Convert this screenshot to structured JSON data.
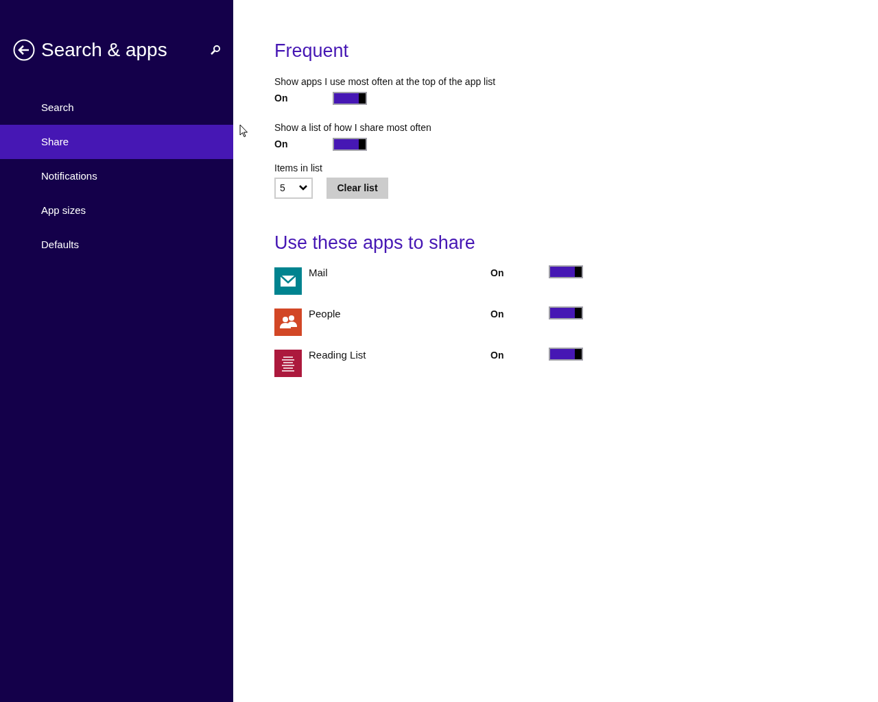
{
  "sidebar": {
    "title": "Search & apps",
    "items": [
      {
        "label": "Search",
        "selected": false
      },
      {
        "label": "Share",
        "selected": true
      },
      {
        "label": "Notifications",
        "selected": false
      },
      {
        "label": "App sizes",
        "selected": false
      },
      {
        "label": "Defaults",
        "selected": false
      }
    ]
  },
  "frequent": {
    "heading": "Frequent",
    "settings": [
      {
        "label": "Show apps I use most often at the top of the app list",
        "state": "On",
        "on": true
      },
      {
        "label": "Show a list of how I share most often",
        "state": "On",
        "on": true
      }
    ],
    "items_in_list": {
      "label": "Items in list",
      "value": "5"
    },
    "clear_button": "Clear list"
  },
  "share_apps": {
    "heading": "Use these apps to share",
    "apps": [
      {
        "name": "Mail",
        "kind": "mail",
        "color": "#00838f",
        "state": "On",
        "on": true
      },
      {
        "name": "People",
        "kind": "people",
        "color": "#d24726",
        "state": "On",
        "on": true
      },
      {
        "name": "Reading List",
        "kind": "reading",
        "color": "#ac193d",
        "state": "On",
        "on": true
      }
    ]
  }
}
